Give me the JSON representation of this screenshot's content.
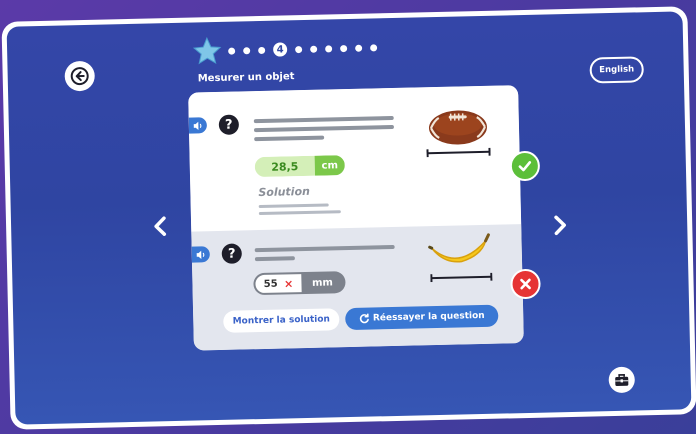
{
  "header": {
    "title": "Mesurer un objet",
    "current_step": "4",
    "language_button": "English"
  },
  "questions": [
    {
      "answer_value": "28,5",
      "answer_unit": "cm",
      "solution_label": "Solution",
      "object_icon": "football-icon",
      "status": "correct"
    },
    {
      "answer_value": "55",
      "answer_unit": "mm",
      "wrong_mark": "×",
      "object_icon": "banana-icon",
      "status": "incorrect",
      "show_solution_button": "Montrer la solution",
      "retry_button": "Réessayer la question"
    }
  ],
  "colors": {
    "background": "#2f45a2",
    "accent_blue": "#3a78d4",
    "correct_green": "#5cbf3a",
    "incorrect_red": "#e63434"
  }
}
